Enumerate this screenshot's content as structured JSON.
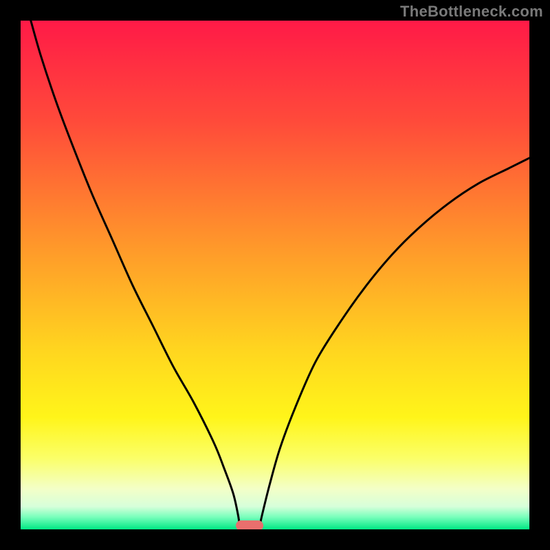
{
  "watermark": "TheBottleneck.com",
  "chart_data": {
    "type": "line",
    "title": "",
    "xlabel": "",
    "ylabel": "",
    "xlim": [
      0,
      100
    ],
    "ylim": [
      0,
      100
    ],
    "gradient_stops": [
      {
        "offset": 0.0,
        "color": "#ff1a47"
      },
      {
        "offset": 0.2,
        "color": "#ff4b3a"
      },
      {
        "offset": 0.45,
        "color": "#ff9a2a"
      },
      {
        "offset": 0.65,
        "color": "#ffd61f"
      },
      {
        "offset": 0.78,
        "color": "#fff51a"
      },
      {
        "offset": 0.86,
        "color": "#fbff68"
      },
      {
        "offset": 0.92,
        "color": "#f3ffc7"
      },
      {
        "offset": 0.955,
        "color": "#d7ffda"
      },
      {
        "offset": 0.975,
        "color": "#7cffbd"
      },
      {
        "offset": 1.0,
        "color": "#00e884"
      }
    ],
    "series": [
      {
        "name": "left-curve",
        "x": [
          2.0,
          4.0,
          7.0,
          10.0,
          14.0,
          18.0,
          22.0,
          26.0,
          30.0,
          34.0,
          38.0,
          40.0,
          41.8,
          42.8,
          43.0
        ],
        "y": [
          100.0,
          93.0,
          84.0,
          76.0,
          66.0,
          57.0,
          48.0,
          40.0,
          32.0,
          25.0,
          17.0,
          12.0,
          7.0,
          2.5,
          0.7
        ]
      },
      {
        "name": "right-curve",
        "x": [
          47.0,
          47.5,
          49.0,
          51.0,
          54.0,
          58.0,
          63.0,
          68.0,
          73.0,
          78.0,
          84.0,
          90.0,
          96.0,
          100.0
        ],
        "y": [
          0.7,
          3.0,
          9.0,
          16.0,
          24.0,
          33.0,
          41.0,
          48.0,
          54.0,
          59.0,
          64.0,
          68.0,
          71.0,
          73.0
        ]
      }
    ],
    "marker": {
      "x": 45.0,
      "y": 0.7,
      "w": 5.5,
      "h": 2.0,
      "color": "#e96f6d"
    }
  }
}
